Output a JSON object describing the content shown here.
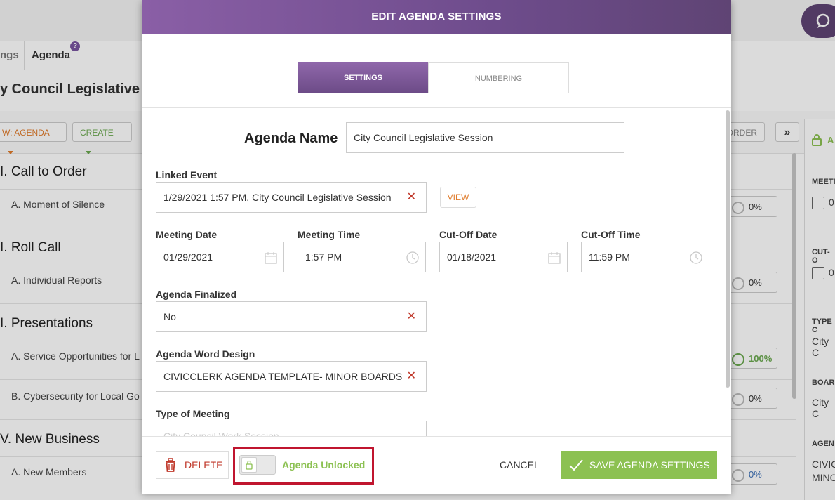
{
  "background": {
    "tabs": {
      "settings_partial": "ngs",
      "agenda": "Agenda",
      "help": "?"
    },
    "title": "y Council Legislative Se",
    "toolbar": {
      "view_agenda": "W: AGENDA",
      "create": "CREATE",
      "order": "ORDER",
      "expand": "»"
    },
    "sections": [
      {
        "heading": "I.  Call to Order",
        "items": [
          {
            "label": "A.  Moment of Silence",
            "progress": "0%"
          }
        ]
      },
      {
        "heading": "I.  Roll Call",
        "items": [
          {
            "label": "A.  Individual Reports",
            "progress": "0%"
          }
        ]
      },
      {
        "heading": "I.  Presentations",
        "items": [
          {
            "label": "A.  Service Opportunities for L",
            "progress": "100%"
          },
          {
            "label": "B.  Cybersecurity for Local Go",
            "progress": "0%"
          }
        ]
      },
      {
        "heading": "V.  New Business",
        "items": [
          {
            "label": "A.  New Members",
            "progress": "0%"
          }
        ]
      }
    ],
    "right_panel": {
      "lock_badge": "A",
      "meeting_label": "MEETI",
      "meeting_val": "0",
      "cutoff_label": "CUT-O",
      "cutoff_val": "0",
      "type_label": "TYPE C",
      "type_val": "City C",
      "board_label": "BOAR",
      "board_val": "City C",
      "agenda_label": "AGEN",
      "agenda_val1": "CIVIC",
      "agenda_val2": "MINC"
    }
  },
  "modal": {
    "title": "EDIT AGENDA SETTINGS",
    "tabs": {
      "settings": "SETTINGS",
      "numbering": "NUMBERING"
    },
    "agenda_name": {
      "label": "Agenda Name",
      "value": "City Council Legislative Session"
    },
    "linked_event": {
      "label": "Linked Event",
      "value": "1/29/2021 1:57 PM, City Council Legislative Session",
      "view": "VIEW"
    },
    "meeting_date": {
      "label": "Meeting Date",
      "value": "01/29/2021"
    },
    "meeting_time": {
      "label": "Meeting Time",
      "value": "1:57 PM"
    },
    "cutoff_date": {
      "label": "Cut-Off Date",
      "value": "01/18/2021"
    },
    "cutoff_time": {
      "label": "Cut-Off Time",
      "value": "11:59 PM"
    },
    "agenda_finalized": {
      "label": "Agenda Finalized",
      "value": "No"
    },
    "word_design": {
      "label": "Agenda Word Design",
      "value": "CIVICCLERK AGENDA TEMPLATE- MINOR BOARDS"
    },
    "type_of_meeting": {
      "label": "Type of Meeting",
      "value": "City Council Work Session"
    },
    "clear_glyph": "✕",
    "footer": {
      "delete": "DELETE",
      "lock_status": "Agenda Unlocked",
      "cancel": "CANCEL",
      "save": "SAVE AGENDA SETTINGS"
    }
  },
  "colors": {
    "accent_purple": "#6e4c8c",
    "save_green": "#8cc152",
    "danger_red": "#c0392b",
    "highlight_red": "#c0152f"
  }
}
